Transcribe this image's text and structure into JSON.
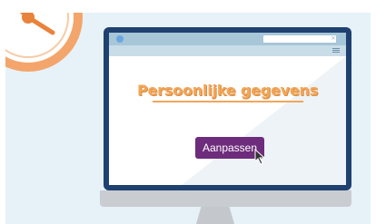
{
  "colors": {
    "background": "#e6f2f8",
    "clock_orange": "#e9823b",
    "monitor_frame": "#1f4170",
    "heading": "#f2a65a",
    "button": "#6d2c7c"
  },
  "icons": {
    "clock": "clock-icon",
    "cursor": "mouse-pointer-icon",
    "menu": "hamburger-menu-icon",
    "close": "close-icon"
  },
  "screen": {
    "heading": "Persoonlijke gegevens",
    "button_label": "Aanpassen",
    "browser_close": "×"
  }
}
